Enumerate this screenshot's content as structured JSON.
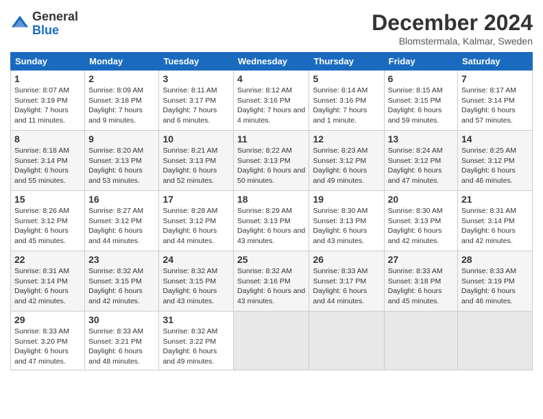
{
  "header": {
    "logo_general": "General",
    "logo_blue": "Blue",
    "month_title": "December 2024",
    "subtitle": "Blomstermala, Kalmar, Sweden"
  },
  "weekdays": [
    "Sunday",
    "Monday",
    "Tuesday",
    "Wednesday",
    "Thursday",
    "Friday",
    "Saturday"
  ],
  "weeks": [
    [
      {
        "day": "1",
        "sunrise": "8:07 AM",
        "sunset": "3:19 PM",
        "daylight": "7 hours and 11 minutes."
      },
      {
        "day": "2",
        "sunrise": "8:09 AM",
        "sunset": "3:18 PM",
        "daylight": "7 hours and 9 minutes."
      },
      {
        "day": "3",
        "sunrise": "8:11 AM",
        "sunset": "3:17 PM",
        "daylight": "7 hours and 6 minutes."
      },
      {
        "day": "4",
        "sunrise": "8:12 AM",
        "sunset": "3:16 PM",
        "daylight": "7 hours and 4 minutes."
      },
      {
        "day": "5",
        "sunrise": "8:14 AM",
        "sunset": "3:16 PM",
        "daylight": "7 hours and 1 minute."
      },
      {
        "day": "6",
        "sunrise": "8:15 AM",
        "sunset": "3:15 PM",
        "daylight": "6 hours and 59 minutes."
      },
      {
        "day": "7",
        "sunrise": "8:17 AM",
        "sunset": "3:14 PM",
        "daylight": "6 hours and 57 minutes."
      }
    ],
    [
      {
        "day": "8",
        "sunrise": "8:18 AM",
        "sunset": "3:14 PM",
        "daylight": "6 hours and 55 minutes."
      },
      {
        "day": "9",
        "sunrise": "8:20 AM",
        "sunset": "3:13 PM",
        "daylight": "6 hours and 53 minutes."
      },
      {
        "day": "10",
        "sunrise": "8:21 AM",
        "sunset": "3:13 PM",
        "daylight": "6 hours and 52 minutes."
      },
      {
        "day": "11",
        "sunrise": "8:22 AM",
        "sunset": "3:13 PM",
        "daylight": "6 hours and 50 minutes."
      },
      {
        "day": "12",
        "sunrise": "8:23 AM",
        "sunset": "3:12 PM",
        "daylight": "6 hours and 49 minutes."
      },
      {
        "day": "13",
        "sunrise": "8:24 AM",
        "sunset": "3:12 PM",
        "daylight": "6 hours and 47 minutes."
      },
      {
        "day": "14",
        "sunrise": "8:25 AM",
        "sunset": "3:12 PM",
        "daylight": "6 hours and 46 minutes."
      }
    ],
    [
      {
        "day": "15",
        "sunrise": "8:26 AM",
        "sunset": "3:12 PM",
        "daylight": "6 hours and 45 minutes."
      },
      {
        "day": "16",
        "sunrise": "8:27 AM",
        "sunset": "3:12 PM",
        "daylight": "6 hours and 44 minutes."
      },
      {
        "day": "17",
        "sunrise": "8:28 AM",
        "sunset": "3:12 PM",
        "daylight": "6 hours and 44 minutes."
      },
      {
        "day": "18",
        "sunrise": "8:29 AM",
        "sunset": "3:13 PM",
        "daylight": "6 hours and 43 minutes."
      },
      {
        "day": "19",
        "sunrise": "8:30 AM",
        "sunset": "3:13 PM",
        "daylight": "6 hours and 43 minutes."
      },
      {
        "day": "20",
        "sunrise": "8:30 AM",
        "sunset": "3:13 PM",
        "daylight": "6 hours and 42 minutes."
      },
      {
        "day": "21",
        "sunrise": "8:31 AM",
        "sunset": "3:14 PM",
        "daylight": "6 hours and 42 minutes."
      }
    ],
    [
      {
        "day": "22",
        "sunrise": "8:31 AM",
        "sunset": "3:14 PM",
        "daylight": "6 hours and 42 minutes."
      },
      {
        "day": "23",
        "sunrise": "8:32 AM",
        "sunset": "3:15 PM",
        "daylight": "6 hours and 42 minutes."
      },
      {
        "day": "24",
        "sunrise": "8:32 AM",
        "sunset": "3:15 PM",
        "daylight": "6 hours and 43 minutes."
      },
      {
        "day": "25",
        "sunrise": "8:32 AM",
        "sunset": "3:16 PM",
        "daylight": "6 hours and 43 minutes."
      },
      {
        "day": "26",
        "sunrise": "8:33 AM",
        "sunset": "3:17 PM",
        "daylight": "6 hours and 44 minutes."
      },
      {
        "day": "27",
        "sunrise": "8:33 AM",
        "sunset": "3:18 PM",
        "daylight": "6 hours and 45 minutes."
      },
      {
        "day": "28",
        "sunrise": "8:33 AM",
        "sunset": "3:19 PM",
        "daylight": "6 hours and 46 minutes."
      }
    ],
    [
      {
        "day": "29",
        "sunrise": "8:33 AM",
        "sunset": "3:20 PM",
        "daylight": "6 hours and 47 minutes."
      },
      {
        "day": "30",
        "sunrise": "8:33 AM",
        "sunset": "3:21 PM",
        "daylight": "6 hours and 48 minutes."
      },
      {
        "day": "31",
        "sunrise": "8:32 AM",
        "sunset": "3:22 PM",
        "daylight": "6 hours and 49 minutes."
      },
      null,
      null,
      null,
      null
    ]
  ]
}
